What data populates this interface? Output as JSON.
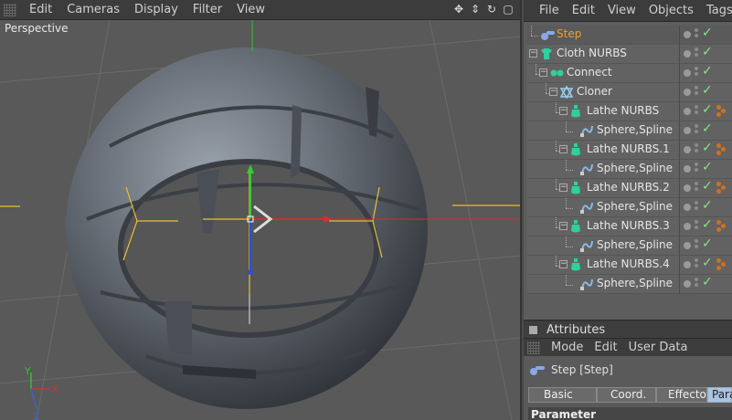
{
  "viewport": {
    "menu": [
      "Edit",
      "Cameras",
      "Display",
      "Filter",
      "View"
    ],
    "label": "Perspective",
    "nav_icons": [
      "move-icon",
      "zoom-icon",
      "rotate-icon",
      "maximize-icon"
    ],
    "axes": {
      "x": "X",
      "y": "Y",
      "z": "Z"
    }
  },
  "object_manager": {
    "menu": [
      "File",
      "Edit",
      "View",
      "Objects",
      "Tags"
    ],
    "objects": [
      {
        "name": "Step",
        "icon": "effector-icon",
        "selected": true
      },
      {
        "name": "Cloth NURBS",
        "icon": "cloth-icon"
      },
      {
        "name": "Connect",
        "icon": "connect-icon"
      },
      {
        "name": "Cloner",
        "icon": "cloner-icon"
      },
      {
        "name": "Lathe NURBS",
        "icon": "lathe-icon"
      },
      {
        "name": "Sphere,Spline",
        "icon": "spline-icon"
      },
      {
        "name": "Lathe NURBS.1",
        "icon": "lathe-icon"
      },
      {
        "name": "Sphere,Spline",
        "icon": "spline-icon"
      },
      {
        "name": "Lathe NURBS.2",
        "icon": "lathe-icon"
      },
      {
        "name": "Sphere,Spline",
        "icon": "spline-icon"
      },
      {
        "name": "Lathe NURBS.3",
        "icon": "lathe-icon"
      },
      {
        "name": "Sphere,Spline",
        "icon": "spline-icon"
      },
      {
        "name": "Lathe NURBS.4",
        "icon": "lathe-icon"
      },
      {
        "name": "Sphere,Spline",
        "icon": "spline-icon"
      }
    ]
  },
  "attributes": {
    "title": "Attributes",
    "menu": [
      "Mode",
      "Edit",
      "User Data"
    ],
    "object_label": "Step [Step]",
    "tabs": [
      "Basic",
      "Coord.",
      "Effector",
      "Para"
    ],
    "active_tab": "Para",
    "section": "Parameter"
  },
  "colors": {
    "selected_text": "#f0a030",
    "check": "#8be08b",
    "active_tab": "#a8c4e0"
  }
}
